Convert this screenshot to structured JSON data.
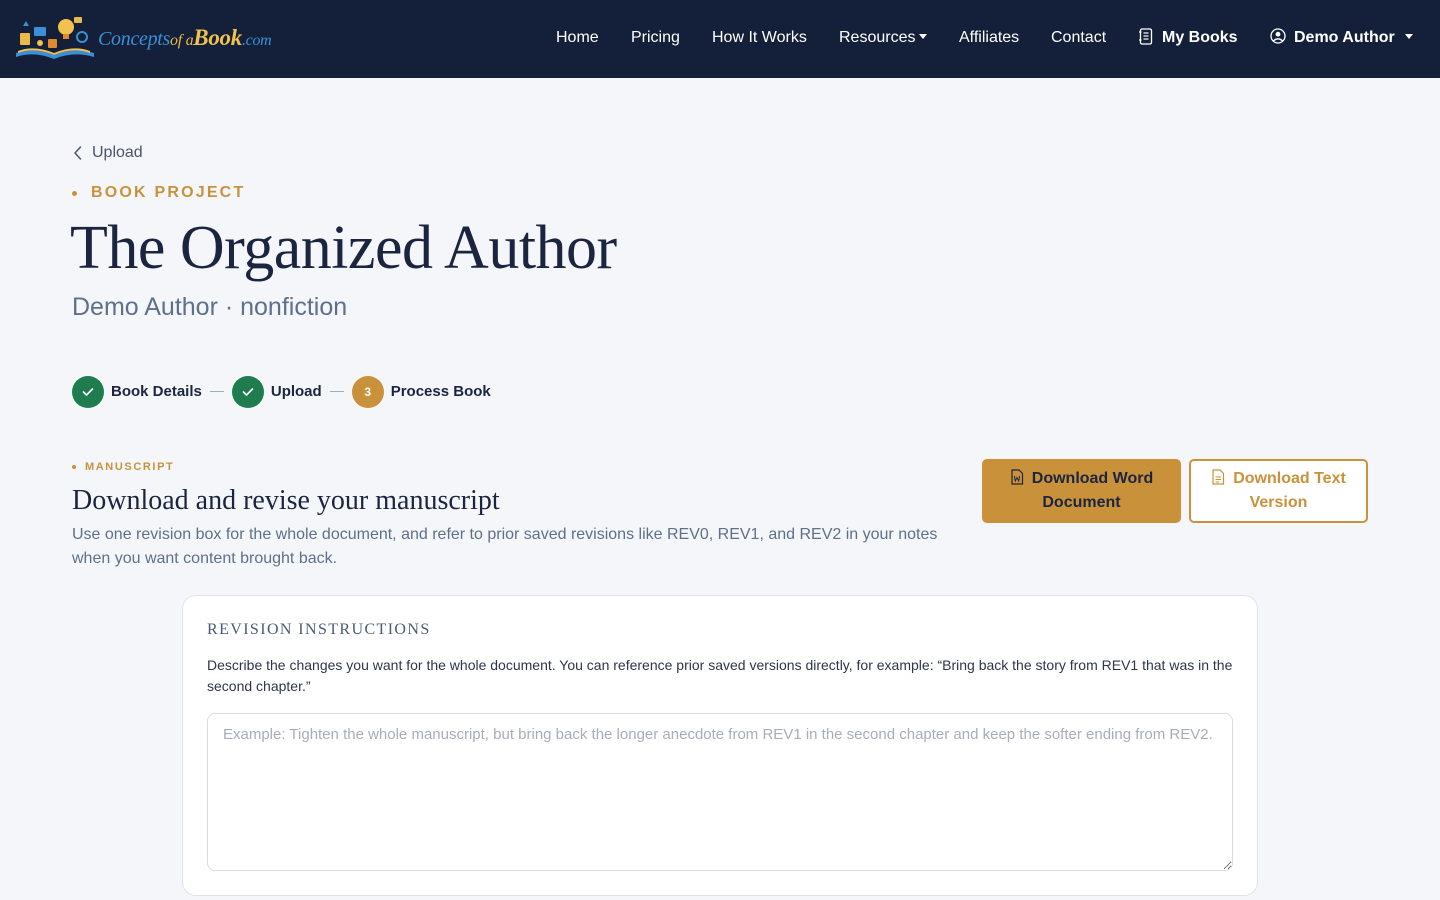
{
  "navbar": {
    "logo": {
      "part1": "Concepts",
      "part2": "of a",
      "part3": "Book",
      "part4": ".com"
    },
    "links": {
      "home": "Home",
      "pricing": "Pricing",
      "how_it_works": "How It Works",
      "resources": "Resources",
      "affiliates": "Affiliates",
      "contact": "Contact",
      "my_books": "My Books",
      "user": "Demo Author"
    }
  },
  "page": {
    "back_label": "Upload",
    "eyebrow": "BOOK PROJECT",
    "title": "The Organized Author",
    "subtitle": "Demo Author · nonfiction"
  },
  "stepper": {
    "steps": [
      {
        "label": "Book Details",
        "state": "done"
      },
      {
        "label": "Upload",
        "state": "done"
      },
      {
        "label": "Process Book",
        "state": "active",
        "number": "3"
      }
    ]
  },
  "manuscript": {
    "eyebrow": "MANUSCRIPT",
    "heading": "Download and revise your manuscript",
    "description": "Use one revision box for the whole document, and refer to prior saved revisions like REV0, REV1, and REV2 in your notes when you want content brought back.",
    "download_word": "Download Word Document",
    "download_text": "Download Text Version"
  },
  "revision": {
    "title": "REVISION INSTRUCTIONS",
    "description": "Describe the changes you want for the whole document. You can reference prior saved versions directly, for example: “Bring back the story from REV1 that was in the second chapter.”",
    "placeholder": "Example: Tighten the whole manuscript, but bring back the longer anecdote from REV1 in the second chapter and keep the softer ending from REV2.",
    "value": ""
  },
  "colors": {
    "navbar_bg": "#14203a",
    "accent_gold": "#c9923a",
    "success_green": "#1e7c4e",
    "page_bg": "#f4f6fa"
  }
}
